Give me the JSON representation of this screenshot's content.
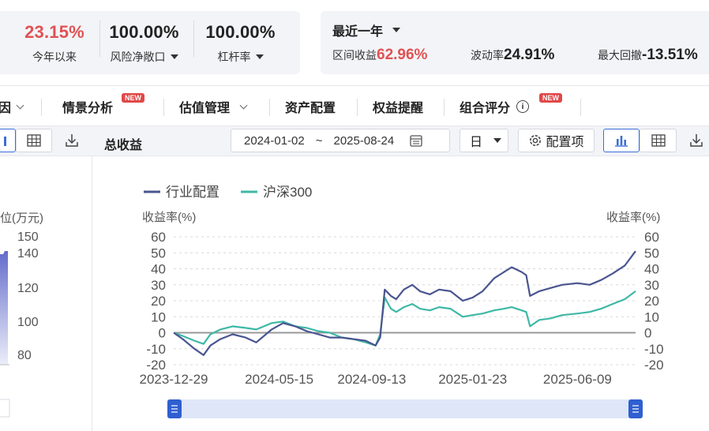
{
  "summary_left": {
    "ytd": {
      "value": "23.15%",
      "label": "今年以来"
    },
    "risk_exposure": {
      "value": "100.00%",
      "label": "风险净敞口"
    },
    "leverage": {
      "value": "100.00%",
      "label": "杠杆率"
    }
  },
  "summary_right": {
    "period_label": "最近一年",
    "range_return_label": "区间收益",
    "range_return_value": "62.96%",
    "volatility_label": "波动率",
    "volatility_value": "24.91%",
    "max_drawdown_label": "最大回撤",
    "max_drawdown_value": "-13.51%"
  },
  "tabs": {
    "factor_partial": "因",
    "scenario": "情景分析",
    "valuation": "估值管理",
    "allocation": "资产配置",
    "equity_alert": "权益提醒",
    "portfolio_score": "组合评分",
    "new_badge": "NEW"
  },
  "toolbar": {
    "title": "总收益",
    "date_start": "2024-01-02",
    "date_sep": "~",
    "date_end": "2025-08-24",
    "granularity": "日",
    "config_label": "配置项"
  },
  "left_chart": {
    "axis_label": "位(万元)",
    "ticks": [
      "150",
      "140",
      "120",
      "100",
      "80"
    ]
  },
  "chart_data": {
    "type": "line",
    "xlabel": "",
    "ylabel_left": "收益率(%)",
    "ylabel_right": "收益率(%)",
    "ylim": [
      -20,
      60
    ],
    "yticks_left": [
      "60",
      "50",
      "40",
      "30",
      "20",
      "10",
      "0",
      "-10",
      "-20"
    ],
    "yticks_right": [
      "60",
      "50",
      "40",
      "30",
      "20",
      "10",
      "0",
      "-10",
      "-20"
    ],
    "xtick_labels": [
      "2023-12-29",
      "2024-05-15",
      "2024-09-13",
      "2025-01-23",
      "2025-06-09"
    ],
    "legend_position": "top-left",
    "series": [
      {
        "name": "行业配置",
        "color": "#4a5590",
        "points": [
          [
            "2023-12-29",
            0
          ],
          [
            "2024-01-10",
            -4
          ],
          [
            "2024-01-25",
            -10
          ],
          [
            "2024-02-06",
            -14
          ],
          [
            "2024-02-15",
            -8
          ],
          [
            "2024-02-28",
            -4
          ],
          [
            "2024-03-15",
            -1
          ],
          [
            "2024-04-01",
            -3
          ],
          [
            "2024-04-15",
            -6
          ],
          [
            "2024-04-25",
            -2
          ],
          [
            "2024-05-05",
            2
          ],
          [
            "2024-05-20",
            6
          ],
          [
            "2024-06-05",
            4
          ],
          [
            "2024-06-20",
            1
          ],
          [
            "2024-07-05",
            -1
          ],
          [
            "2024-07-20",
            -3
          ],
          [
            "2024-08-05",
            -3
          ],
          [
            "2024-08-20",
            -4
          ],
          [
            "2024-09-05",
            -5
          ],
          [
            "2024-09-18",
            -8
          ],
          [
            "2024-09-24",
            -3
          ],
          [
            "2024-09-30",
            27
          ],
          [
            "2024-10-08",
            23
          ],
          [
            "2024-10-15",
            21
          ],
          [
            "2024-10-25",
            27
          ],
          [
            "2024-11-05",
            30
          ],
          [
            "2024-11-15",
            26
          ],
          [
            "2024-11-28",
            24
          ],
          [
            "2024-12-10",
            27
          ],
          [
            "2024-12-25",
            26
          ],
          [
            "2025-01-10",
            20
          ],
          [
            "2025-01-23",
            22
          ],
          [
            "2025-02-05",
            26
          ],
          [
            "2025-02-20",
            34
          ],
          [
            "2025-03-05",
            38
          ],
          [
            "2025-03-15",
            41
          ],
          [
            "2025-03-28",
            38
          ],
          [
            "2025-04-03",
            36
          ],
          [
            "2025-04-08",
            23
          ],
          [
            "2025-04-20",
            26
          ],
          [
            "2025-05-05",
            28
          ],
          [
            "2025-05-20",
            30
          ],
          [
            "2025-06-09",
            31
          ],
          [
            "2025-06-25",
            30
          ],
          [
            "2025-07-10",
            33
          ],
          [
            "2025-07-25",
            37
          ],
          [
            "2025-08-10",
            42
          ],
          [
            "2025-08-24",
            51
          ]
        ]
      },
      {
        "name": "沪深300",
        "color": "#3fb8a6",
        "points": [
          [
            "2023-12-29",
            0
          ],
          [
            "2024-01-10",
            -2
          ],
          [
            "2024-01-25",
            -5
          ],
          [
            "2024-02-06",
            -7
          ],
          [
            "2024-02-15",
            -1
          ],
          [
            "2024-02-28",
            2
          ],
          [
            "2024-03-15",
            4
          ],
          [
            "2024-04-01",
            3
          ],
          [
            "2024-04-15",
            2
          ],
          [
            "2024-04-25",
            4
          ],
          [
            "2024-05-05",
            6
          ],
          [
            "2024-05-20",
            7
          ],
          [
            "2024-06-05",
            4
          ],
          [
            "2024-06-20",
            3
          ],
          [
            "2024-07-05",
            1
          ],
          [
            "2024-07-20",
            0
          ],
          [
            "2024-08-05",
            -3
          ],
          [
            "2024-08-20",
            -4
          ],
          [
            "2024-09-05",
            -6
          ],
          [
            "2024-09-18",
            -8
          ],
          [
            "2024-09-24",
            -1
          ],
          [
            "2024-09-30",
            22
          ],
          [
            "2024-10-08",
            15
          ],
          [
            "2024-10-15",
            13
          ],
          [
            "2024-10-25",
            16
          ],
          [
            "2024-11-05",
            18
          ],
          [
            "2024-11-15",
            15
          ],
          [
            "2024-11-28",
            14
          ],
          [
            "2024-12-10",
            16
          ],
          [
            "2024-12-25",
            15
          ],
          [
            "2025-01-10",
            10
          ],
          [
            "2025-01-23",
            11
          ],
          [
            "2025-02-05",
            12
          ],
          [
            "2025-02-20",
            14
          ],
          [
            "2025-03-05",
            15
          ],
          [
            "2025-03-15",
            16
          ],
          [
            "2025-03-28",
            14
          ],
          [
            "2025-04-03",
            13
          ],
          [
            "2025-04-08",
            4
          ],
          [
            "2025-04-20",
            8
          ],
          [
            "2025-05-05",
            9
          ],
          [
            "2025-05-20",
            11
          ],
          [
            "2025-06-09",
            12
          ],
          [
            "2025-06-25",
            13
          ],
          [
            "2025-07-10",
            15
          ],
          [
            "2025-07-25",
            18
          ],
          [
            "2025-08-10",
            21
          ],
          [
            "2025-08-24",
            26
          ]
        ]
      }
    ]
  }
}
